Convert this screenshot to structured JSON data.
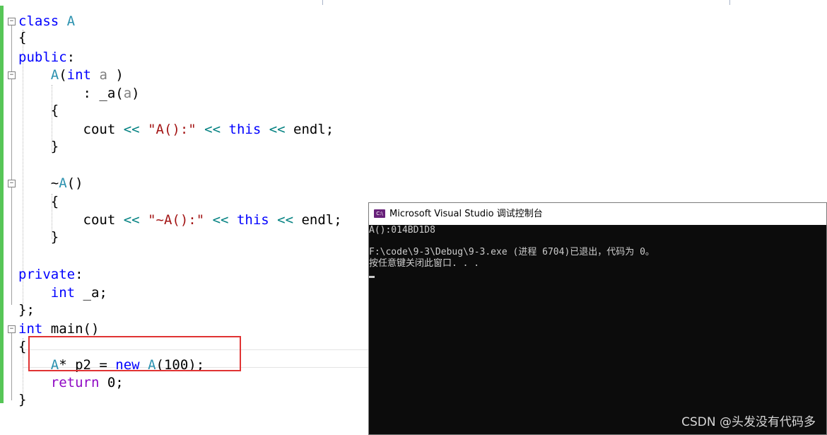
{
  "editor": {
    "lines": [
      {
        "tokens": [
          [
            "kw",
            "class"
          ],
          [
            "id",
            " "
          ],
          [
            "ty",
            "A"
          ]
        ]
      },
      {
        "tokens": [
          [
            "id",
            "{"
          ]
        ]
      },
      {
        "tokens": [
          [
            "kw",
            "public"
          ],
          [
            "id",
            ":"
          ]
        ]
      },
      {
        "tokens": [
          [
            "id",
            "    "
          ],
          [
            "ty",
            "A"
          ],
          [
            "id",
            "("
          ],
          [
            "kw",
            "int"
          ],
          [
            "id",
            " "
          ],
          [
            "pa",
            "a"
          ],
          [
            "id",
            " )"
          ]
        ]
      },
      {
        "tokens": [
          [
            "id",
            "        : _a("
          ],
          [
            "pa",
            "a"
          ],
          [
            "id",
            ")"
          ]
        ]
      },
      {
        "tokens": [
          [
            "id",
            "    {"
          ]
        ]
      },
      {
        "tokens": [
          [
            "id",
            "        cout "
          ],
          [
            "op",
            "<<"
          ],
          [
            "id",
            " "
          ],
          [
            "st",
            "\"A():\""
          ],
          [
            "id",
            " "
          ],
          [
            "op",
            "<<"
          ],
          [
            "id",
            " "
          ],
          [
            "kw",
            "this"
          ],
          [
            "id",
            " "
          ],
          [
            "op",
            "<<"
          ],
          [
            "id",
            " endl;"
          ]
        ]
      },
      {
        "tokens": [
          [
            "id",
            "    }"
          ]
        ]
      },
      {
        "tokens": [
          [
            "id",
            ""
          ]
        ]
      },
      {
        "tokens": [
          [
            "id",
            "    ~"
          ],
          [
            "ty",
            "A"
          ],
          [
            "id",
            "()"
          ]
        ]
      },
      {
        "tokens": [
          [
            "id",
            "    {"
          ]
        ]
      },
      {
        "tokens": [
          [
            "id",
            "        cout "
          ],
          [
            "op",
            "<<"
          ],
          [
            "id",
            " "
          ],
          [
            "st",
            "\"~A():\""
          ],
          [
            "id",
            " "
          ],
          [
            "op",
            "<<"
          ],
          [
            "id",
            " "
          ],
          [
            "kw",
            "this"
          ],
          [
            "id",
            " "
          ],
          [
            "op",
            "<<"
          ],
          [
            "id",
            " endl;"
          ]
        ]
      },
      {
        "tokens": [
          [
            "id",
            "    }"
          ]
        ]
      },
      {
        "tokens": [
          [
            "id",
            ""
          ]
        ]
      },
      {
        "tokens": [
          [
            "kw",
            "private"
          ],
          [
            "id",
            ":"
          ]
        ]
      },
      {
        "tokens": [
          [
            "id",
            "    "
          ],
          [
            "kw",
            "int"
          ],
          [
            "id",
            " _a;"
          ]
        ]
      },
      {
        "tokens": [
          [
            "id",
            "};"
          ]
        ]
      },
      {
        "tokens": [
          [
            "kw",
            "int"
          ],
          [
            "id",
            " main()"
          ]
        ]
      },
      {
        "tokens": [
          [
            "id",
            "{"
          ]
        ]
      },
      {
        "tokens": [
          [
            "id",
            "    "
          ],
          [
            "ty",
            "A"
          ],
          [
            "id",
            "* p2 = "
          ],
          [
            "kw",
            "new"
          ],
          [
            "id",
            " "
          ],
          [
            "ty",
            "A"
          ],
          [
            "id",
            "(100);"
          ]
        ]
      },
      {
        "tokens": [
          [
            "id",
            "    "
          ],
          [
            "pu",
            "return"
          ],
          [
            "id",
            " 0;"
          ]
        ]
      },
      {
        "tokens": [
          [
            "id",
            "}"
          ]
        ]
      }
    ],
    "fold_markers": [
      "−",
      "−",
      "−",
      "−"
    ]
  },
  "console": {
    "title": "Microsoft Visual Studio 调试控制台",
    "icon_label": "C:\\",
    "output": [
      "A():014BD1D8",
      "",
      "F:\\code\\9-3\\Debug\\9-3.exe (进程 6704)已退出，代码为 0。",
      "按任意键关闭此窗口. . ."
    ]
  },
  "watermark": "CSDN @头发没有代码多",
  "colors": {
    "keyword": "#0000ff",
    "type": "#2b91af",
    "string": "#a31515",
    "operator": "#008080",
    "param": "#808080",
    "return": "#8f08c4",
    "highlight_box": "#e03333"
  }
}
